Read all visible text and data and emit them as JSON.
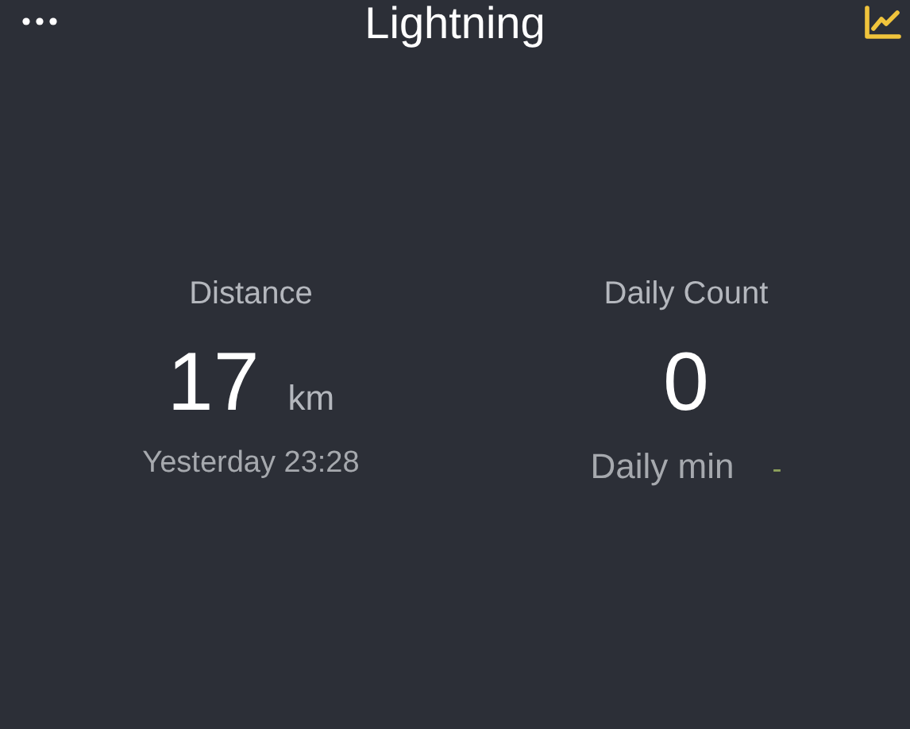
{
  "header": {
    "title": "Lightning"
  },
  "tiles": [
    {
      "label": "Distance",
      "value": "17",
      "unit": "km",
      "footer": "Yesterday 23:28"
    },
    {
      "label": "Daily Count",
      "value": "0",
      "footer_label": "Daily min",
      "footer_value": "-"
    }
  ]
}
